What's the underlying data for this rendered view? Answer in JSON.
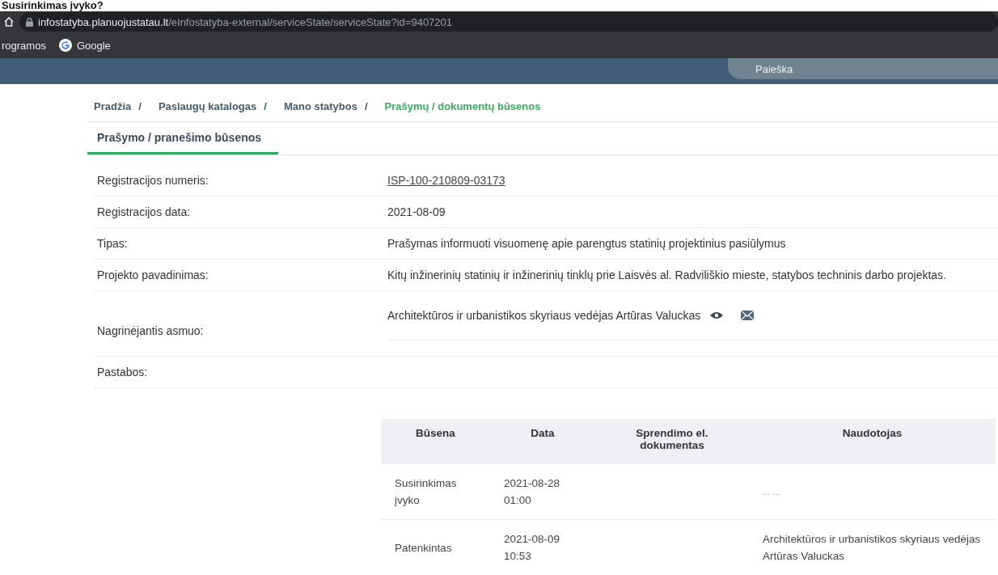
{
  "page_heading": "Susirinkimas įvyko?",
  "browser": {
    "address_host": "infostatyba.planuojustatau.lt",
    "address_path": "/eInfostatyba-external/serviceState/serviceState?id=9407201",
    "bookmarks": [
      {
        "label": "rogramos",
        "kind": "folder"
      },
      {
        "label": "Google",
        "kind": "google"
      }
    ]
  },
  "header": {
    "search_placeholder": "Paieška"
  },
  "breadcrumb": [
    {
      "label": "Pradžia",
      "current": false,
      "separator": "/"
    },
    {
      "label": "Paslaugų katalogas",
      "current": false,
      "separator": "/"
    },
    {
      "label": "Mano statybos",
      "current": false,
      "separator": "/"
    },
    {
      "label": "Prašymų / dokumentų būsenos",
      "current": true
    }
  ],
  "tabs": [
    {
      "label": "Prašymo / pranešimo būsenos",
      "selected": true
    }
  ],
  "details": [
    {
      "kind": "link",
      "label": "Registracijos numeris:",
      "value": "ISP-100-210809-03173"
    },
    {
      "kind": "text",
      "label": "Registracijos data:",
      "value": "2021-08-09"
    },
    {
      "kind": "text",
      "label": "Tipas:",
      "value": "Prašymas informuoti visuomenę apie parengtus statinių projektinius pasiūlymus"
    },
    {
      "kind": "text",
      "label": "Projekto pavadinimas:",
      "value": "Kitų inžinerinių statinių ir inžinerinių tinklų prie Laisvės al. Radviliškio mieste, statybos techninis darbo projektas."
    },
    {
      "kind": "person",
      "label": "Nagrinėjantis asmuo:",
      "value": "Architektūros ir urbanistikos skyriaus vedėjas Artūras Valuckas"
    },
    {
      "kind": "empty",
      "label": "Pastabos:"
    }
  ],
  "status_table": {
    "columns": [
      "Būsena",
      "Data",
      "Sprendimo el. dokumentas",
      "Naudotojas"
    ],
    "rows": [
      {
        "status": "Susirinkimas įvyko",
        "date": "2021-08-28 01:00",
        "user": "... ...",
        "user_muted": true
      },
      {
        "status": "Patenkintas",
        "date": "2021-08-09 10:53",
        "user": "Architektūros ir urbanistikos skyriaus vedėjas Artūras Valuckas",
        "user_muted": false
      }
    ]
  }
}
